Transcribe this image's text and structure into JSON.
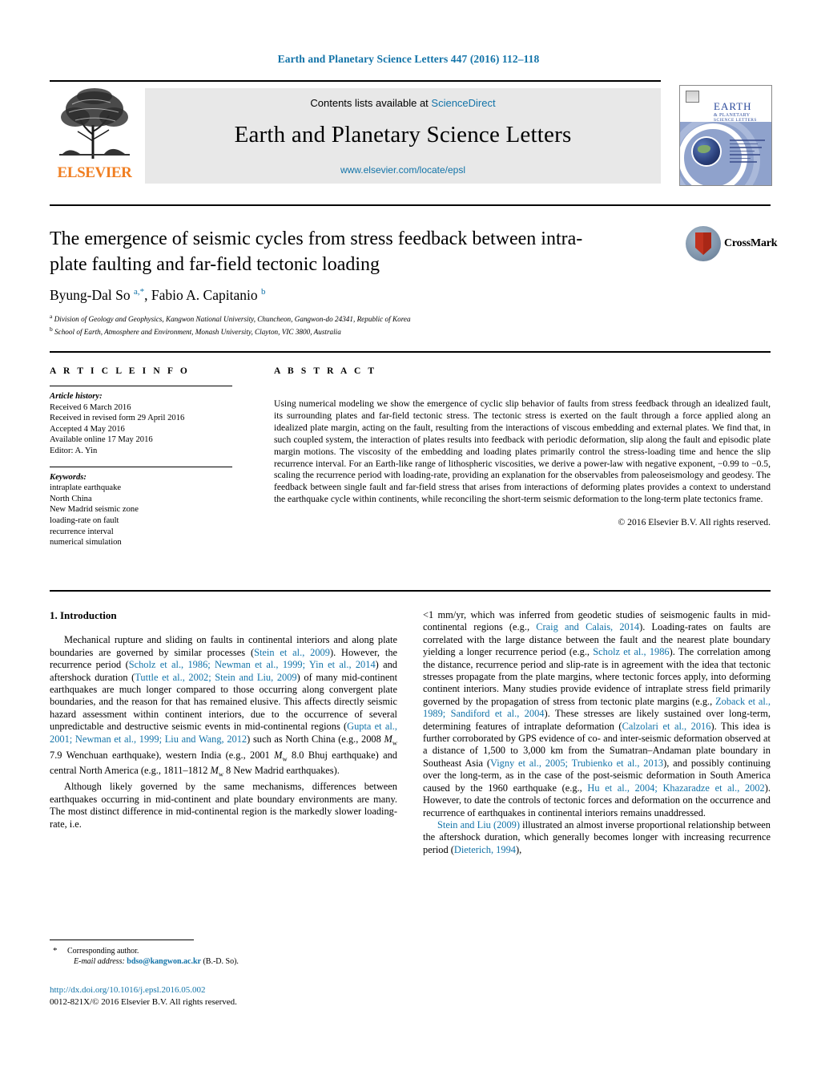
{
  "running_head": "Earth and Planetary Science Letters 447 (2016) 112–118",
  "masthead": {
    "contents_prefix": "Contents lists available at ",
    "sciencedirect": "ScienceDirect",
    "journal_title": "Earth and Planetary Science Letters",
    "journal_url": "www.elsevier.com/locate/epsl",
    "publisher": "ELSEVIER",
    "cover": {
      "line1": "EARTH",
      "line2": "& PLANETARY",
      "line3": "SCIENCE LETTERS"
    }
  },
  "article": {
    "title": "The emergence of seismic cycles from stress feedback between intra-plate faulting and far-field tectonic loading",
    "authors_html": "Byung-Dal So <sup>a,*</sup>, Fabio A. Capitanio <sup>b</sup>",
    "affiliation_a": "Division of Geology and Geophysics, Kangwon National University, Chuncheon, Gangwon-do 24341, Republic of Korea",
    "affiliation_b": "School of Earth, Atmosphere and Environment, Monash University, Clayton, VIC 3800, Australia",
    "crossmark_label": "CrossMark"
  },
  "article_info": {
    "heading": "A R T I C L E   I N F O",
    "history_label": "Article history:",
    "history": [
      "Received 6 March 2016",
      "Received in revised form 29 April 2016",
      "Accepted 4 May 2016",
      "Available online 17 May 2016",
      "Editor: A. Yin"
    ],
    "keywords_label": "Keywords:",
    "keywords": [
      "intraplate earthquake",
      "North China",
      "New Madrid seismic zone",
      "loading-rate on fault",
      "recurrence interval",
      "numerical simulation"
    ]
  },
  "abstract": {
    "heading": "A B S T R A C T",
    "text": "Using numerical modeling we show the emergence of cyclic slip behavior of faults from stress feedback through an idealized fault, its surrounding plates and far-field tectonic stress. The tectonic stress is exerted on the fault through a force applied along an idealized plate margin, acting on the fault, resulting from the interactions of viscous embedding and external plates. We find that, in such coupled system, the interaction of plates results into feedback with periodic deformation, slip along the fault and episodic plate margin motions. The viscosity of the embedding and loading plates primarily control the stress-loading time and hence the slip recurrence interval. For an Earth-like range of lithospheric viscosities, we derive a power-law with negative exponent, −0.99 to −0.5, scaling the recurrence period with loading-rate, providing an explanation for the observables from paleoseismology and geodesy. The feedback between single fault and far-field stress that arises from interactions of deforming plates provides a context to understand the earthquake cycle within continents, while reconciling the short-term seismic deformation to the long-term plate tectonics frame.",
    "copyright": "© 2016 Elsevier B.V. All rights reserved."
  },
  "body": {
    "section_heading": "1. Introduction",
    "left_para1_html": "Mechanical rupture and sliding on faults in continental interiors and along plate boundaries are governed by similar processes (<span class=\"cite\">Stein et al., 2009</span>). However, the recurrence period (<span class=\"cite\">Scholz et al., 1986; Newman et al., 1999; Yin et al., 2014</span>) and aftershock duration (<span class=\"cite\">Tuttle et al., 2002; Stein and Liu, 2009</span>) of many mid-continent earthquakes are much longer compared to those occurring along convergent plate boundaries, and the reason for that has remained elusive. This affects directly seismic hazard assessment within continent interiors, due to the occurrence of several unpredictable and destructive seismic events in mid-continental regions (<span class=\"cite\">Gupta et al., 2001; Newman et al., 1999; Liu and Wang, 2012</span>) such as North China (e.g., 2008 <span class=\"mw\">M<sub>w</sub></span> 7.9 Wenchuan earthquake), western India (e.g., 2001 <span class=\"mw\">M<sub>w</sub></span> 8.0 Bhuj earthquake) and central North America (e.g., 1811–1812 <span class=\"mw\">M<sub>w</sub></span> 8 New Madrid earthquakes).",
    "left_para2_html": "Although likely governed by the same mechanisms, differences between earthquakes occurring in mid-continent and plate boundary environments are many. The most distinct difference in mid-continental region is the markedly slower loading-rate, i.e.",
    "right_para1_html": "&lt;1 mm/yr, which was inferred from geodetic studies of seismogenic faults in mid-continental regions (e.g., <span class=\"cite\">Craig and Calais, 2014</span>). Loading-rates on faults are correlated with the large distance between the fault and the nearest plate boundary yielding a longer recurrence period (e.g., <span class=\"cite\">Scholz et al., 1986</span>). The correlation among the distance, recurrence period and slip-rate is in agreement with the idea that tectonic stresses propagate from the plate margins, where tectonic forces apply, into deforming continent interiors. Many studies provide evidence of intraplate stress field primarily governed by the propagation of stress from tectonic plate margins (e.g., <span class=\"cite\">Zoback et al., 1989; Sandiford et al., 2004</span>). These stresses are likely sustained over long-term, determining features of intraplate deformation (<span class=\"cite\">Calzolari et al., 2016</span>). This idea is further corroborated by GPS evidence of co- and inter-seismic deformation observed at a distance of 1,500 to 3,000 km from the Sumatran–Andaman plate boundary in Southeast Asia (<span class=\"cite\">Vigny et al., 2005; Trubienko et al., 2013</span>), and possibly continuing over the long-term, as in the case of the post-seismic deformation in South America caused by the 1960 earthquake (e.g., <span class=\"cite\">Hu et al., 2004; Khazaradze et al., 2002</span>). However, to date the controls of tectonic forces and deformation on the occurrence and recurrence of earthquakes in continental interiors remains unaddressed.",
    "right_para2_html": "<span class=\"cite\">Stein and Liu (2009)</span> illustrated an almost inverse proportional relationship between the aftershock duration, which generally becomes longer with increasing recurrence period (<span class=\"cite\">Dieterich, 1994</span>),"
  },
  "footer": {
    "corresponding_author": "Corresponding author.",
    "email_label": "E-mail address:",
    "email": "bdso@kangwon.ac.kr",
    "email_suffix": "(B.-D. So).",
    "doi": "http://dx.doi.org/10.1016/j.epsl.2016.05.002",
    "issn_line": "0012-821X/© 2016 Elsevier B.V. All rights reserved."
  },
  "colors": {
    "link": "#1273a8",
    "elsevier_orange": "#f07e20",
    "banner_bg": "#e8e8e8"
  }
}
